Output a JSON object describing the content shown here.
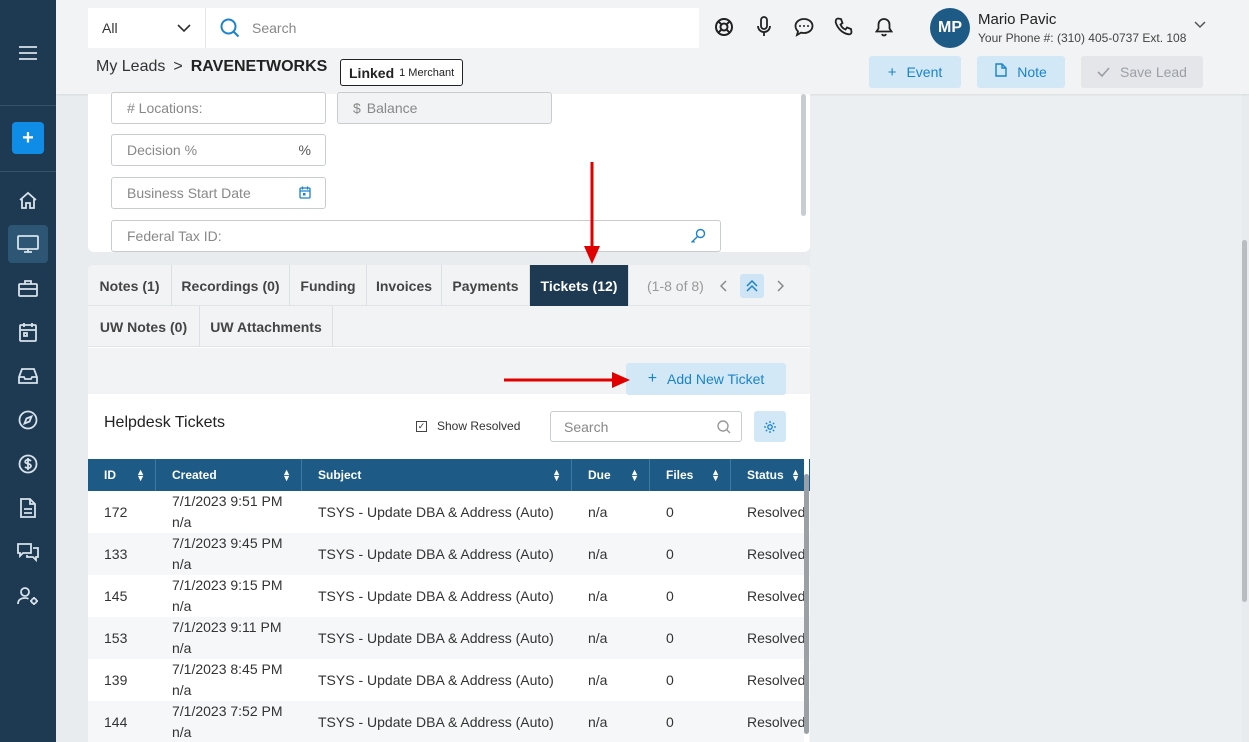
{
  "sidebar": {
    "items": [
      "menu-icon",
      "add-icon",
      "home-icon",
      "desktop-icon",
      "briefcase-icon",
      "calendar-icon",
      "inbox-icon",
      "compass-icon",
      "dollar-icon",
      "document-icon",
      "chat-icon",
      "user-settings-icon"
    ],
    "add_label": "+"
  },
  "header": {
    "scope": "All",
    "search_placeholder": "Search",
    "user": {
      "initials": "MP",
      "name": "Mario Pavic",
      "phone": "Your Phone #: (310) 405-0737 Ext. 108"
    },
    "breadcrumb": {
      "parent": "My Leads",
      "separator": ">",
      "current": "RAVENETWORKS"
    },
    "linked": {
      "label": "Linked",
      "count": "1 Merchant"
    },
    "buttons": {
      "event": "Event",
      "note": "Note",
      "save": "Save Lead"
    }
  },
  "form": {
    "locations_placeholder": "# Locations:",
    "balance_placeholder": "Balance",
    "decision_placeholder": "Decision %",
    "decision_suffix": "%",
    "start_date_placeholder": "Business Start Date",
    "tax_id_placeholder": "Federal Tax ID:"
  },
  "tabs": {
    "row1": [
      {
        "label": "Notes",
        "count": "(1)"
      },
      {
        "label": "Recordings",
        "count": "(0)"
      },
      {
        "label": "Funding",
        "count": ""
      },
      {
        "label": "Invoices",
        "count": ""
      },
      {
        "label": "Payments",
        "count": ""
      },
      {
        "label": "Tickets",
        "count": "(12)"
      }
    ],
    "row2": [
      {
        "label": "UW Notes",
        "count": "(0)"
      },
      {
        "label": "UW Attachments",
        "count": ""
      }
    ],
    "active": "Tickets",
    "pager": "(1-8 of 8)"
  },
  "tickets": {
    "add_button": "Add New Ticket",
    "title": "Helpdesk Tickets",
    "show_resolved": "Show Resolved",
    "show_resolved_checked": true,
    "search_placeholder": "Search",
    "columns": [
      "ID",
      "Created",
      "Subject",
      "Due",
      "Files",
      "Status"
    ],
    "rows": [
      {
        "id": "172",
        "created": "7/1/2023 9:51 PM",
        "by": "n/a",
        "subject": "TSYS - Update DBA & Address (Auto)",
        "due": "n/a",
        "files": "0",
        "status": "Resolved"
      },
      {
        "id": "133",
        "created": "7/1/2023 9:45 PM",
        "by": "n/a",
        "subject": "TSYS - Update DBA & Address (Auto)",
        "due": "n/a",
        "files": "0",
        "status": "Resolved"
      },
      {
        "id": "145",
        "created": "7/1/2023 9:15 PM",
        "by": "n/a",
        "subject": "TSYS - Update DBA & Address (Auto)",
        "due": "n/a",
        "files": "0",
        "status": "Resolved"
      },
      {
        "id": "153",
        "created": "7/1/2023 9:11 PM",
        "by": "n/a",
        "subject": "TSYS - Update DBA & Address (Auto)",
        "due": "n/a",
        "files": "0",
        "status": "Resolved"
      },
      {
        "id": "139",
        "created": "7/1/2023 8:45 PM",
        "by": "n/a",
        "subject": "TSYS - Update DBA & Address (Auto)",
        "due": "n/a",
        "files": "0",
        "status": "Resolved"
      },
      {
        "id": "144",
        "created": "7/1/2023 7:52 PM",
        "by": "n/a",
        "subject": "TSYS - Update DBA & Address (Auto)",
        "due": "n/a",
        "files": "0",
        "status": "Resolved"
      }
    ]
  },
  "colors": {
    "sidebar": "#1d3a52",
    "accent": "#1a83cc",
    "table_header": "#1d5a85",
    "annotation_arrow": "#e00000"
  }
}
